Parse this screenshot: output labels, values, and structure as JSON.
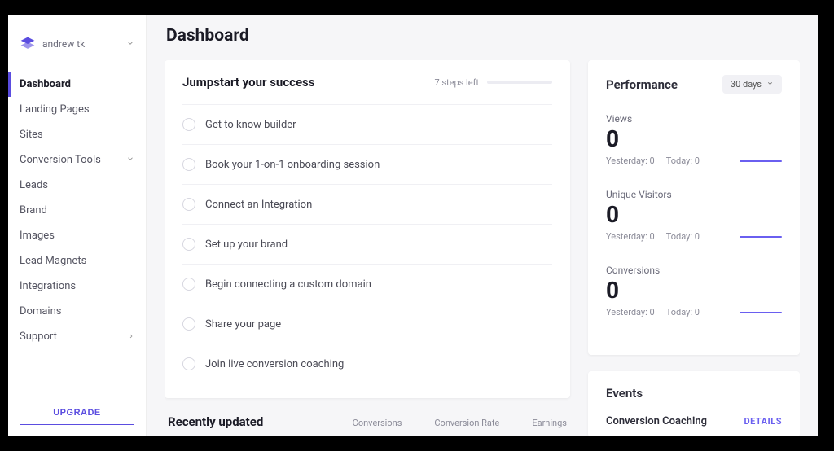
{
  "account": {
    "name": "andrew tk"
  },
  "sidebar": {
    "items": [
      {
        "label": "Dashboard",
        "active": true
      },
      {
        "label": "Landing Pages"
      },
      {
        "label": "Sites"
      },
      {
        "label": "Conversion Tools",
        "expandable": true
      },
      {
        "label": "Leads"
      },
      {
        "label": "Brand"
      },
      {
        "label": "Images"
      },
      {
        "label": "Lead Magnets"
      },
      {
        "label": "Integrations"
      },
      {
        "label": "Domains"
      },
      {
        "label": "Support",
        "expandable": true
      }
    ],
    "upgrade_label": "UPGRADE"
  },
  "page_title": "Dashboard",
  "jumpstart": {
    "title": "Jumpstart your success",
    "steps_left": "7 steps left",
    "tasks": [
      "Get to know builder",
      "Book your 1-on-1 onboarding session",
      "Connect an Integration",
      "Set up your brand",
      "Begin connecting a custom domain",
      "Share your page",
      "Join live conversion coaching"
    ]
  },
  "recent": {
    "title": "Recently updated",
    "columns": [
      "Conversions",
      "Conversion Rate",
      "Earnings"
    ]
  },
  "performance": {
    "title": "Performance",
    "range": "30 days",
    "metrics": [
      {
        "label": "Views",
        "value": "0",
        "yesterday": "Yesterday: 0",
        "today": "Today: 0"
      },
      {
        "label": "Unique Visitors",
        "value": "0",
        "yesterday": "Yesterday: 0",
        "today": "Today: 0"
      },
      {
        "label": "Conversions",
        "value": "0",
        "yesterday": "Yesterday: 0",
        "today": "Today: 0"
      }
    ]
  },
  "events": {
    "title": "Events",
    "items": [
      {
        "name": "Conversion Coaching",
        "action": "DETAILS"
      }
    ]
  }
}
